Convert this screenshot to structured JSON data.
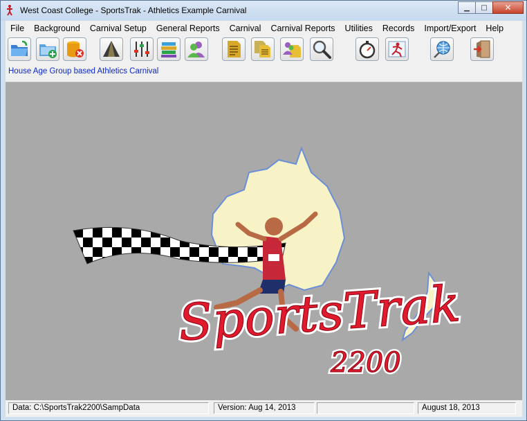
{
  "window": {
    "title": "West Coast College - SportsTrak - Athletics  Example Carnival"
  },
  "menu": [
    "File",
    "Background",
    "Carnival Setup",
    "General Reports",
    "Carnival",
    "Carnival Reports",
    "Utilities",
    "Records",
    "Import/Export",
    "Help"
  ],
  "info_text": "House Age Group based Athletics Carnival",
  "logo": {
    "main": "SportsTrak",
    "number": "2200"
  },
  "status": {
    "data_path": "Data: C:\\SportsTrak2200\\SampData",
    "version": "Version: Aug 14, 2013",
    "blank": "",
    "date": "August 18, 2013"
  },
  "colors": {
    "accent": "#0b27c9",
    "logo_red": "#e01b2d",
    "australia": "#f7f3c7"
  }
}
